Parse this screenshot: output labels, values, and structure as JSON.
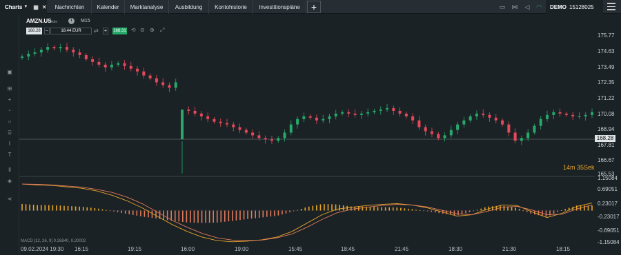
{
  "topbar": {
    "charts_tab": "Charts",
    "nav_tabs": [
      "Nachrichten",
      "Kalender",
      "Marktanalyse",
      "Ausbildung",
      "Kontohistorie",
      "Investitionspläne"
    ],
    "account_type": "DEMO",
    "account_number": "15128025"
  },
  "instrument": {
    "symbol": "AMZN.US",
    "subtitle": "Aktie",
    "timeframe": "M15",
    "bid": "168.28",
    "quantity": "18.44 EUR",
    "ask": "168.31"
  },
  "countdown": {
    "minutes": "14m",
    "seconds": "35Sek"
  },
  "price_axis": {
    "labels": [
      "175.77",
      "174.63",
      "173.49",
      "172.35",
      "171.22",
      "170.08",
      "168.94",
      "167.81",
      "166.67",
      "165.53"
    ],
    "current_price": "168.28"
  },
  "macd": {
    "legend": "MACD [12, 26, 9] 0.26840, 0.20002",
    "axis_labels": [
      "1.15084",
      "0.69051",
      "0.23017",
      "-0.23017",
      "-0.69051",
      "-1.15084"
    ]
  },
  "time_axis": {
    "start_label": "09.02.2024 19:30",
    "labels": [
      "16:15",
      "19:15",
      "16:00",
      "19:00",
      "15:45",
      "18:45",
      "21:45",
      "18:30",
      "21:30",
      "18:15"
    ]
  },
  "colors": {
    "bull": "#26a96a",
    "bear": "#e5495a",
    "macd_line": "#e8a52a",
    "signal_line": "#e07a5a",
    "background": "#1b2226"
  },
  "chart_data": {
    "type": "candlestick",
    "symbol": "AMZN.US",
    "timeframe": "M15",
    "ylim": [
      165.53,
      175.77
    ],
    "close_path": [
      174.2,
      174.4,
      174.5,
      174.7,
      174.9,
      174.8,
      174.9,
      174.7,
      174.5,
      174.3,
      174.0,
      173.8,
      173.6,
      173.4,
      173.6,
      173.7,
      173.5,
      173.3,
      173.1,
      172.8,
      172.6,
      172.3,
      172.1,
      171.9,
      172.3,
      170.3,
      170.2,
      170.0,
      169.8,
      169.6,
      169.4,
      169.3,
      169.2,
      169.0,
      168.8,
      168.6,
      168.4,
      168.2,
      168.1,
      168.0,
      168.2,
      168.6,
      169.2,
      169.6,
      169.8,
      169.7,
      169.5,
      169.6,
      169.8,
      170.0,
      170.1,
      170.0,
      169.9,
      170.0,
      170.1,
      170.2,
      170.3,
      170.4,
      170.2,
      170.0,
      169.8,
      169.5,
      169.0,
      168.7,
      168.5,
      168.2,
      168.4,
      168.8,
      169.2,
      169.5,
      169.8,
      170.0,
      169.9,
      169.7,
      169.5,
      169.2,
      168.6,
      168.0,
      168.2,
      168.6,
      169.1,
      169.6,
      169.9,
      170.1,
      170.0,
      169.9,
      169.8,
      169.8,
      169.9,
      170.1
    ],
    "macd": [
      0.95,
      0.92,
      0.9,
      0.85,
      0.8,
      0.7,
      0.55,
      0.35,
      0.1,
      -0.2,
      -0.5,
      -0.75,
      -0.95,
      -1.08,
      -1.12,
      -1.1,
      -1.05,
      -0.95,
      -0.75,
      -0.45,
      -0.15,
      0.05,
      0.12,
      0.18,
      0.22,
      0.25,
      0.2,
      0.1,
      -0.05,
      -0.2,
      -0.15,
      0.05,
      0.2,
      0.18,
      -0.05,
      -0.25,
      -0.1,
      0.15,
      0.27
    ],
    "signal": [
      0.95,
      0.94,
      0.92,
      0.88,
      0.84,
      0.76,
      0.65,
      0.48,
      0.25,
      -0.05,
      -0.35,
      -0.6,
      -0.82,
      -0.98,
      -1.06,
      -1.08,
      -1.06,
      -0.98,
      -0.84,
      -0.6,
      -0.32,
      -0.08,
      0.05,
      0.12,
      0.18,
      0.22,
      0.2,
      0.13,
      0.01,
      -0.12,
      -0.15,
      -0.03,
      0.12,
      0.15,
      0.02,
      -0.15,
      -0.13,
      0.06,
      0.2
    ]
  }
}
